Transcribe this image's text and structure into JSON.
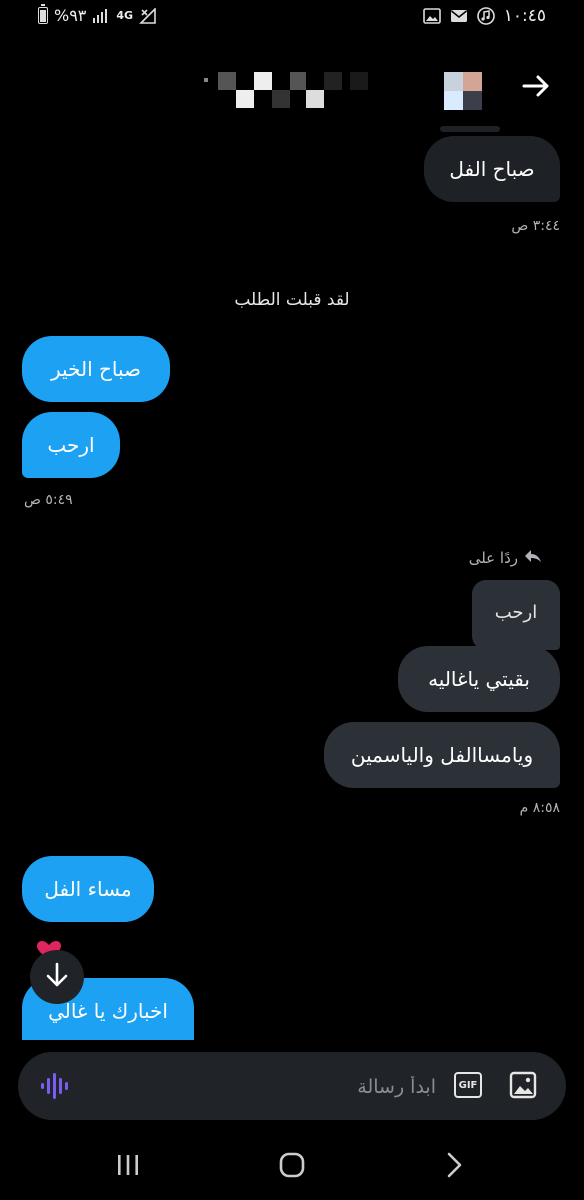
{
  "status_bar": {
    "battery_text": "%٩٣",
    "network_text": "4G",
    "time": "١٠:٤٥"
  },
  "header": {
    "back_icon": "arrow-right-icon",
    "avatar_alt": "profile-avatar"
  },
  "messages": {
    "m1": {
      "text": "صباح الفل",
      "timestamp": "٣:٤٤ ص"
    },
    "system": "لقد قبلت الطلب",
    "m2": {
      "text": "صباح الخير"
    },
    "m3": {
      "text": "ارحب",
      "timestamp": "٥:٤٩ ص"
    },
    "reply_header": "ردًا على",
    "quoted": "ارحب",
    "m4": {
      "text": "بقيتي ياغاليه"
    },
    "m5": {
      "text": "ويامساالفل والياسمين",
      "timestamp": "٨:٥٨ م"
    },
    "m6": {
      "text": "مساء الفل"
    },
    "m7": {
      "text": "اخبارك يا غالي"
    }
  },
  "composer": {
    "placeholder": "ابدأ رسالة",
    "gif_label": "GIF"
  },
  "colors": {
    "incoming_bubble": "#1da1f2",
    "outgoing_bubble": "#1e2227",
    "background": "#000000",
    "voice_accent": "#7b5cf0"
  }
}
